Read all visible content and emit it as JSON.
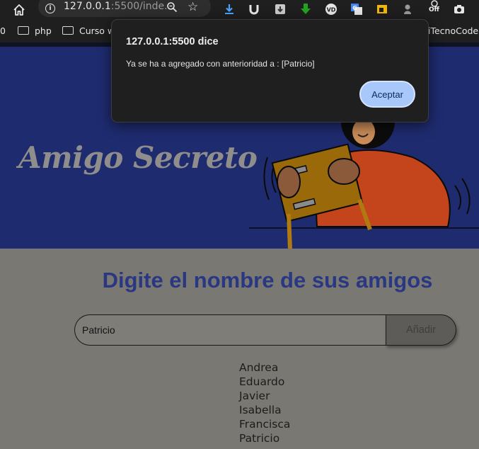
{
  "browser": {
    "url_host": "127.0.0.1",
    "url_rest": ":5500/inde...",
    "off_label": "Off",
    "bookmarks": {
      "partial_left": "0",
      "php": "php",
      "curso": "Curso we",
      "tecnocode": "iTecnoCode"
    }
  },
  "page": {
    "app_title": "Amigo Secreto",
    "heading": "Digite el nombre de sus amigos",
    "input_value": "Patricio",
    "add_label": "Añadir",
    "friends": [
      "Andrea",
      "Eduardo",
      "Javier",
      "Isabella",
      "Francisca",
      "Patricio"
    ]
  },
  "dialog": {
    "title": "127.0.0.1:5500 dice",
    "message": "Ya se ha a agregado con anterioridad a : [Patricio]",
    "ok_label": "Aceptar"
  },
  "colors": {
    "header_bg": "#1e2b6e",
    "heading": "#2a3882",
    "dialog_button": "#a8c7fa",
    "overlay_bg": "#7a7872"
  }
}
